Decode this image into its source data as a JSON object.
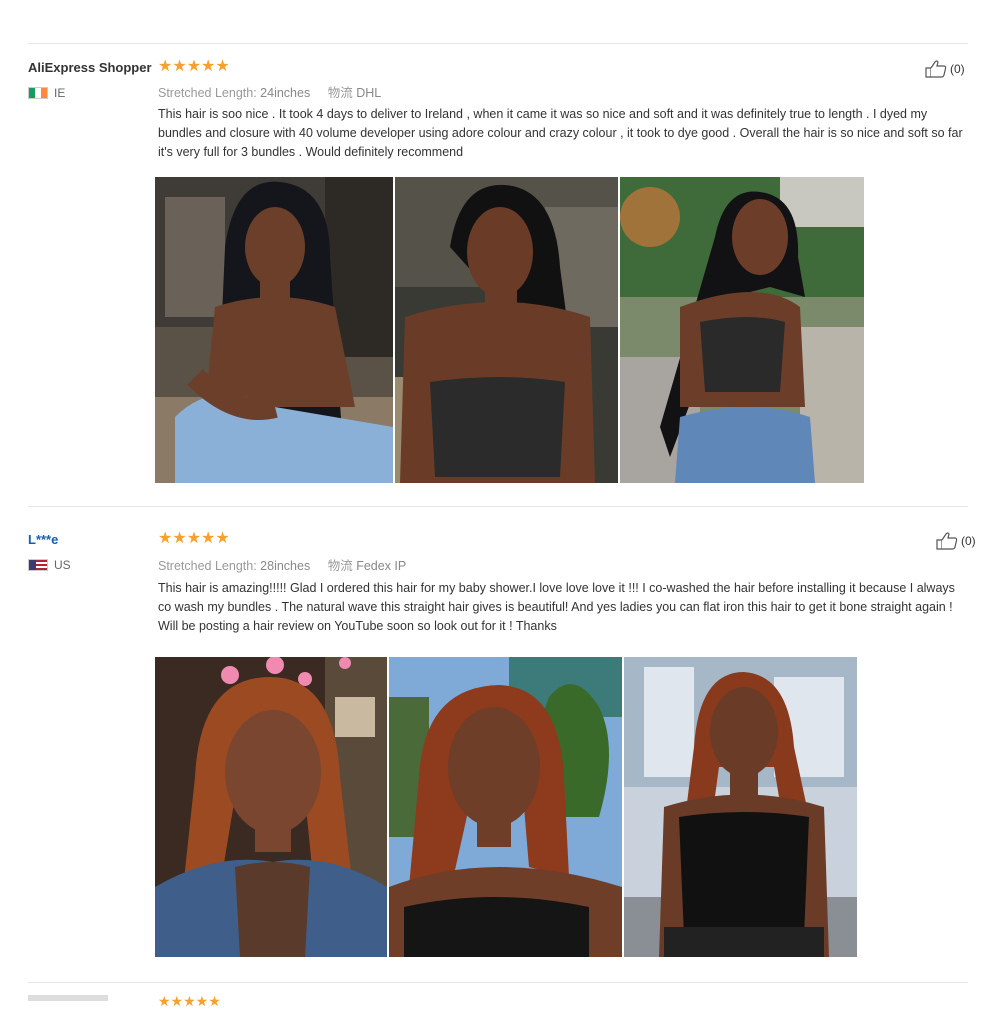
{
  "reviews": [
    {
      "user": "AliExpress Shopper",
      "country": "IE",
      "stars": "★★★★★",
      "attr1_key": "Stretched Length:",
      "attr1_val": "24inches",
      "attr2_key": "物流",
      "attr2_val": "DHL",
      "helpful": "(0)",
      "text": "This hair is soo nice . It took 4 days to deliver to Ireland , when it came it was so nice and soft and it was definitely true to length . I dyed my bundles and closure with 40 volume developer using adore colour and crazy colour , it took to dye good . Overall the hair is so nice and soft so far it's very full for 3 bundles . Would definitely recommend",
      "flag_colors": [
        "#169b62",
        "#ffffff",
        "#ff883e"
      ]
    },
    {
      "user": "L***e",
      "country": "US",
      "stars": "★★★★★",
      "attr1_key": "Stretched Length:",
      "attr1_val": "28inches",
      "attr2_key": "物流",
      "attr2_val": "Fedex IP",
      "helpful": "(0)",
      "text": "This hair is amazing!!!!! Glad I ordered this hair for my baby shower.I love love love it !!! I co-washed the hair before installing it because I always co wash my bundles . The natural wave this straight hair gives is beautiful! And yes ladies you can flat iron this hair to get it bone straight again ! Will be posting a hair review on YouTube soon so look out for it ! Thanks",
      "flag_colors": [
        "#b22234",
        "#ffffff",
        "#3c3b6e"
      ]
    }
  ],
  "next_review_stars": "★★★★★",
  "colors": {
    "star": "#f7a12d",
    "link": "#1a5cb0",
    "divider": "#e6e6e6"
  }
}
